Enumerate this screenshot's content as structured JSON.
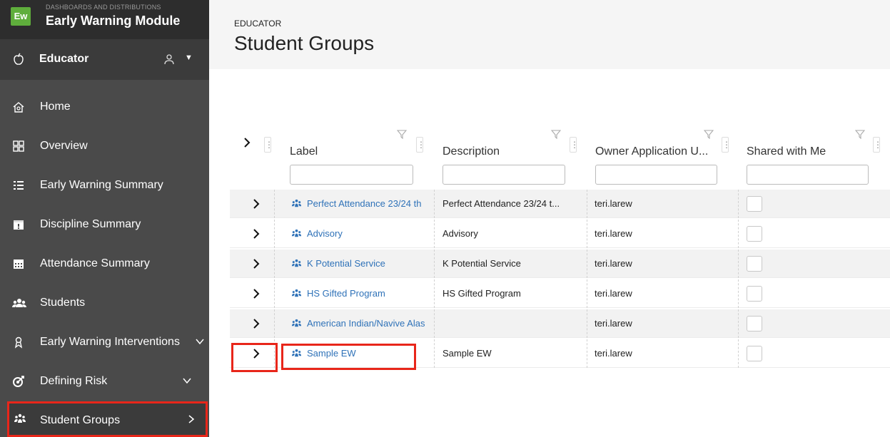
{
  "sidebar": {
    "brand_logo": "Ew",
    "brand_subtitle": "DASHBOARDS AND DISTRIBUTIONS",
    "brand_title": "Early Warning Module",
    "role_label": "Educator",
    "items": [
      {
        "label": "Home",
        "icon": "home-icon"
      },
      {
        "label": "Overview",
        "icon": "grid-icon"
      },
      {
        "label": "Early Warning Summary",
        "icon": "list-icon"
      },
      {
        "label": "Discipline Summary",
        "icon": "calendar-alert-icon"
      },
      {
        "label": "Attendance Summary",
        "icon": "calendar-icon"
      },
      {
        "label": "Students",
        "icon": "students-icon"
      },
      {
        "label": "Early Warning Interventions",
        "icon": "ribbon-icon"
      },
      {
        "label": "Defining Risk",
        "icon": "target-icon"
      },
      {
        "label": "Student Groups",
        "icon": "group-icon"
      }
    ]
  },
  "header": {
    "breadcrumb": "EDUCATOR",
    "title": "Student Groups"
  },
  "table": {
    "columns": [
      "Label",
      "Description",
      "Owner Application U...",
      "Shared with Me"
    ],
    "rows": [
      {
        "label": "Perfect Attendance 23/24 th",
        "description": "Perfect Attendance 23/24 t...",
        "owner": "teri.larew",
        "shared": false
      },
      {
        "label": "Advisory",
        "description": "Advisory",
        "owner": "teri.larew",
        "shared": false
      },
      {
        "label": "K Potential Service",
        "description": "K Potential Service",
        "owner": "teri.larew",
        "shared": false
      },
      {
        "label": "HS Gifted Program",
        "description": "HS Gifted Program",
        "owner": "teri.larew",
        "shared": false
      },
      {
        "label": "American Indian/Navive Alas",
        "description": "",
        "owner": "teri.larew",
        "shared": false
      },
      {
        "label": "Sample EW",
        "description": "Sample EW",
        "owner": "teri.larew",
        "shared": false
      }
    ]
  },
  "colors": {
    "sidebar_bg": "#4a4a4a",
    "brand_green": "#5fae3c",
    "link_blue": "#2f72b8",
    "highlight_red": "#e8261a"
  }
}
